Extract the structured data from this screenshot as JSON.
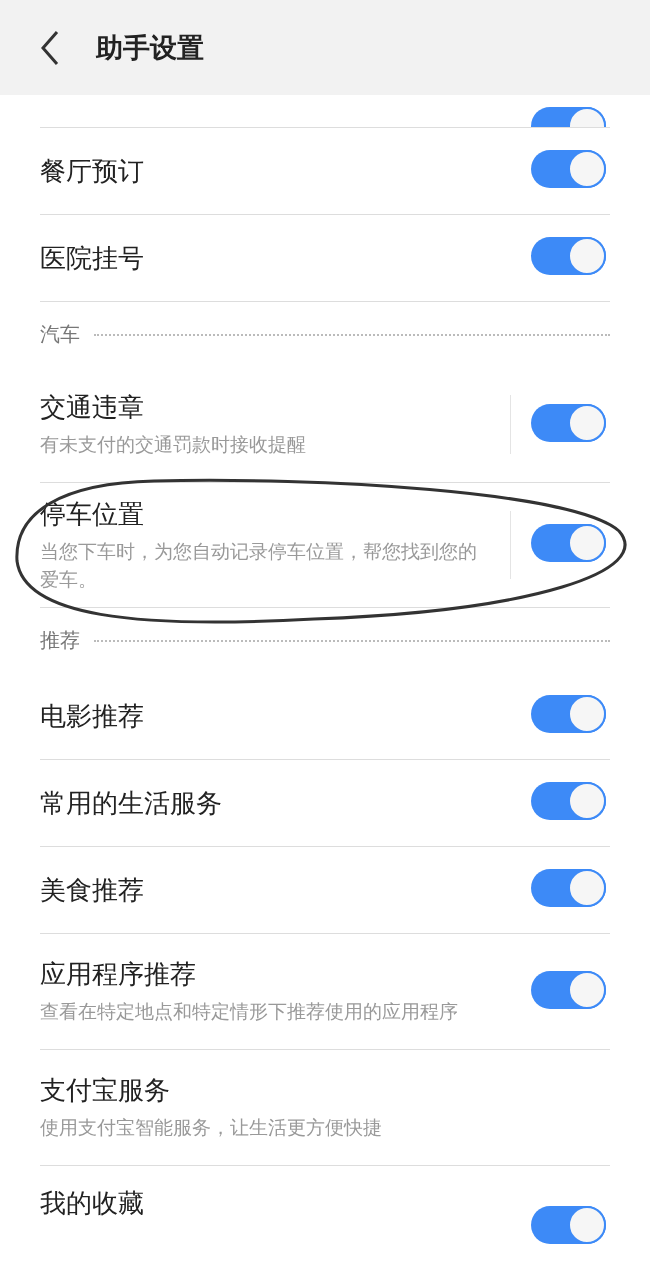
{
  "header": {
    "title": "助手设置"
  },
  "partial_row": {
    "on": true
  },
  "sections": [
    {
      "items": [
        {
          "kind": "toggle",
          "title": "餐厅预订",
          "on": true
        },
        {
          "kind": "toggle",
          "title": "医院挂号",
          "on": true
        }
      ]
    },
    {
      "label": "汽车",
      "items": [
        {
          "kind": "toggle",
          "title": "交通违章",
          "subtitle": "有未支付的交通罚款时接收提醒",
          "on": true,
          "split": true
        },
        {
          "kind": "toggle",
          "title": "停车位置",
          "subtitle": "当您下车时，为您自动记录停车位置，帮您找到您的爱车。",
          "on": true,
          "split": true,
          "circled": true
        }
      ]
    },
    {
      "label": "推荐",
      "items": [
        {
          "kind": "toggle",
          "title": "电影推荐",
          "on": true
        },
        {
          "kind": "toggle",
          "title": "常用的生活服务",
          "on": true
        },
        {
          "kind": "toggle",
          "title": "美食推荐",
          "on": true
        },
        {
          "kind": "toggle",
          "title": "应用程序推荐",
          "subtitle": "查看在特定地点和特定情形下推荐使用的应用程序",
          "on": true
        },
        {
          "kind": "plain",
          "title": "支付宝服务",
          "subtitle": "使用支付宝智能服务，让生活更方便快捷"
        },
        {
          "kind": "toggle",
          "title": "我的收藏",
          "on": true
        }
      ]
    }
  ]
}
